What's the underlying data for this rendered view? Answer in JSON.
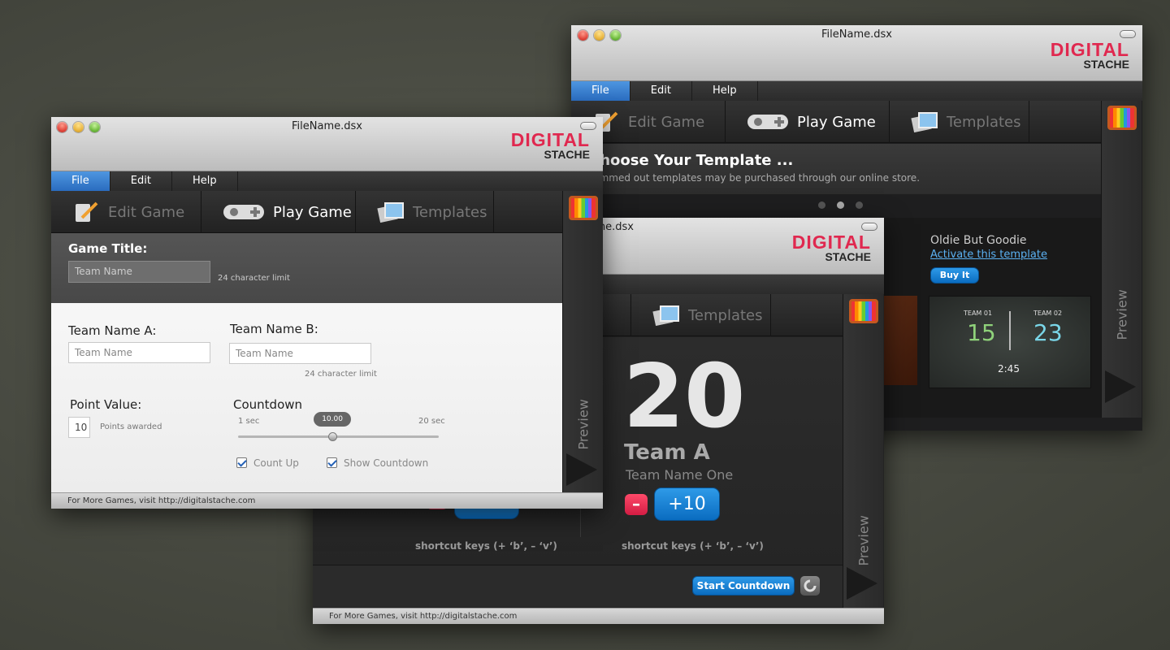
{
  "window_back": {
    "title": "FileName.dsx",
    "logo": {
      "line1": "DIGITAL",
      "line2": "STACHE"
    },
    "menu": [
      "File",
      "Edit",
      "Help"
    ],
    "tabs": [
      {
        "label": "Edit Game",
        "icon": "notepad-pencil-icon"
      },
      {
        "label": "Play Game",
        "icon": "gamepad-icon"
      },
      {
        "label": "Templates",
        "icon": "templates-icon"
      }
    ],
    "heading": "Choose Your Template ...",
    "subheading": "Dimmed out templates may be purchased through our online store.",
    "template": {
      "name": "Oldie But Goodie",
      "activate_link": "Activate this template",
      "buy_button": "Buy It",
      "thumb": {
        "team1_label": "TEAM 01",
        "team1_score": "15",
        "team2_label": "TEAM 02",
        "team2_score": "23",
        "time": "2:45"
      }
    },
    "sidebar_label": "Preview"
  },
  "window_middle": {
    "title": "FileName.dsx",
    "logo": {
      "line1": "DIGITAL",
      "line2": "STACHE"
    },
    "tabs": [
      {
        "label": "Templates",
        "icon": "templates-icon"
      }
    ],
    "score": "20",
    "team_name": "Team A",
    "team_subname": "Team Name One",
    "minus_label": "–",
    "plus_label": "+10",
    "shortcut_left": "shortcut keys (+ ‘b’, – ‘v’)",
    "shortcut_right": "shortcut keys (+ ‘b’, – ‘v’)",
    "start_button": "Start Countdown",
    "sidebar_label": "Preview",
    "status": "For More Games, visit http://digitalstache.com"
  },
  "window_front": {
    "title": "FileName.dsx",
    "logo": {
      "line1": "DIGITAL",
      "line2": "STACHE"
    },
    "menu": [
      "File",
      "Edit",
      "Help"
    ],
    "tabs": [
      {
        "label": "Edit Game",
        "icon": "notepad-pencil-icon"
      },
      {
        "label": "Play Game",
        "icon": "gamepad-icon"
      },
      {
        "label": "Templates",
        "icon": "templates-icon"
      }
    ],
    "game_title_label": "Game Title:",
    "game_title_placeholder": "Team Name",
    "game_title_limit": "24 character limit",
    "team_a_label": "Team Name A:",
    "team_a_placeholder": "Team Name",
    "team_b_label": "Team Name B:",
    "team_b_placeholder": "Team Name",
    "team_b_limit": "24 character limit",
    "point_value_label": "Point Value:",
    "point_value": "10",
    "points_awarded": "Points awarded",
    "countdown_label": "Countdown",
    "slider_min": "1 sec",
    "slider_max": "20 sec",
    "slider_value": "10.00",
    "slider_fraction": 0.47,
    "count_up": "Count Up",
    "show_countdown": "Show Countdown",
    "sidebar_label": "Preview",
    "status": "For More Games, visit http://digitalstache.com"
  },
  "colors": {
    "accent_blue": "#1a82d6",
    "brand_red": "#e0284f",
    "menu_active": "#3a82d2"
  }
}
